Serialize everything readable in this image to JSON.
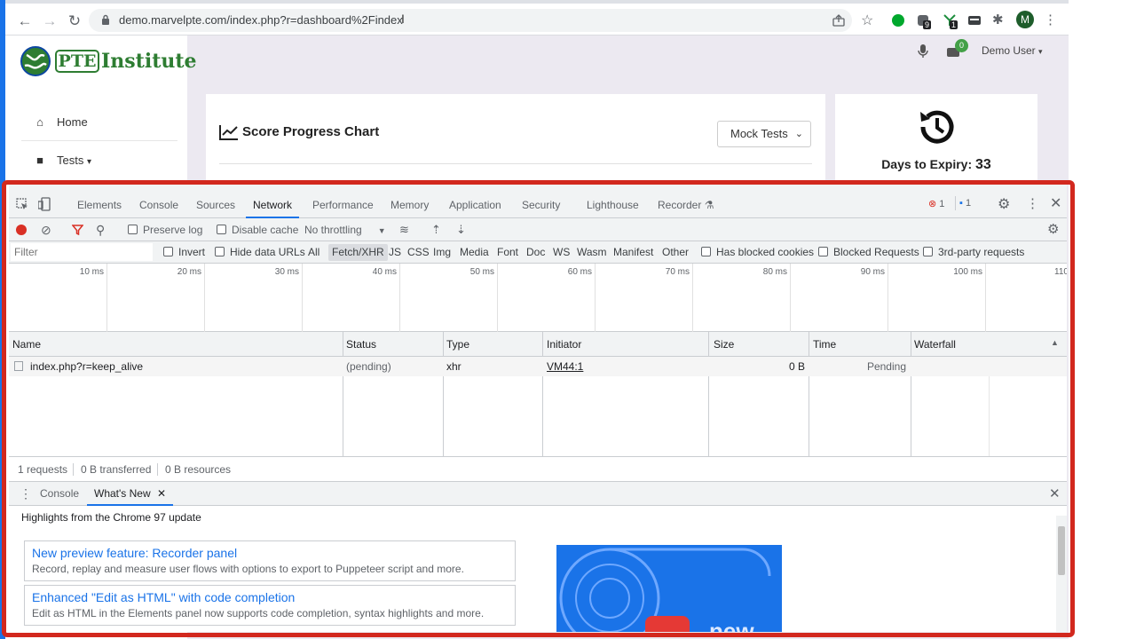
{
  "browser": {
    "url": "demo.marvelpte.com/index.php?r=dashboard%2Findex",
    "profile_initial": "M",
    "ext_badges": [
      "9",
      "1"
    ]
  },
  "site": {
    "logo_pte": "PTE",
    "logo_institute": "Institute",
    "nav": [
      {
        "label": "Home",
        "icon": "home-icon"
      },
      {
        "label": "Tests",
        "icon": "book-icon",
        "caret": "▾"
      }
    ],
    "notification_count": "0",
    "user_label": "Demo User"
  },
  "dashboard": {
    "chart_title": "Score Progress Chart",
    "mock_select": "Mock Tests",
    "expiry_label": "Days to Expiry:",
    "expiry_value": "33"
  },
  "devtools": {
    "tabs": [
      "Elements",
      "Console",
      "Sources",
      "Network",
      "Performance",
      "Memory",
      "Application",
      "Security",
      "Lighthouse",
      "Recorder"
    ],
    "active_tab": "Network",
    "error_count": "1",
    "message_count": "1",
    "toolbar": {
      "preserve_log": "Preserve log",
      "disable_cache": "Disable cache",
      "throttling": "No throttling"
    },
    "filter": {
      "placeholder": "Filter",
      "invert": "Invert",
      "hide_data_urls": "Hide data URLs",
      "types": [
        "All",
        "Fetch/XHR",
        "JS",
        "CSS",
        "Img",
        "Media",
        "Font",
        "Doc",
        "WS",
        "Wasm",
        "Manifest",
        "Other"
      ],
      "selected_type": "Fetch/XHR",
      "has_blocked_cookies": "Has blocked cookies",
      "blocked_requests": "Blocked Requests",
      "third_party": "3rd-party requests"
    },
    "overview_ticks": [
      "10 ms",
      "20 ms",
      "30 ms",
      "40 ms",
      "50 ms",
      "60 ms",
      "70 ms",
      "80 ms",
      "90 ms",
      "100 ms",
      "110"
    ],
    "columns": [
      "Name",
      "Status",
      "Type",
      "Initiator",
      "Size",
      "Time",
      "Waterfall"
    ],
    "rows": [
      {
        "name": "index.php?r=keep_alive",
        "status": "(pending)",
        "type": "xhr",
        "initiator": "VM44:1",
        "size": "0 B",
        "time": "Pending"
      }
    ],
    "summary": {
      "requests": "1 requests",
      "transferred": "0 B transferred",
      "resources": "0 B resources"
    },
    "drawer": {
      "tabs": [
        "Console",
        "What's New"
      ],
      "active": "What's New",
      "highlights": "Highlights from the Chrome 97 update",
      "items": [
        {
          "title": "New preview feature: Recorder panel",
          "desc": "Record, replay and measure user flows with options to export to Puppeteer script and more."
        },
        {
          "title": "Enhanced \"Edit as HTML\" with code completion",
          "desc": "Edit as HTML in the Elements panel now supports code completion, syntax highlights and more."
        }
      ],
      "video_text": "new"
    }
  },
  "colors": {
    "accent": "#1a73e8",
    "frame": "#d2281e",
    "brand_green": "#2e7d32",
    "page_bg": "#ece9f1"
  }
}
